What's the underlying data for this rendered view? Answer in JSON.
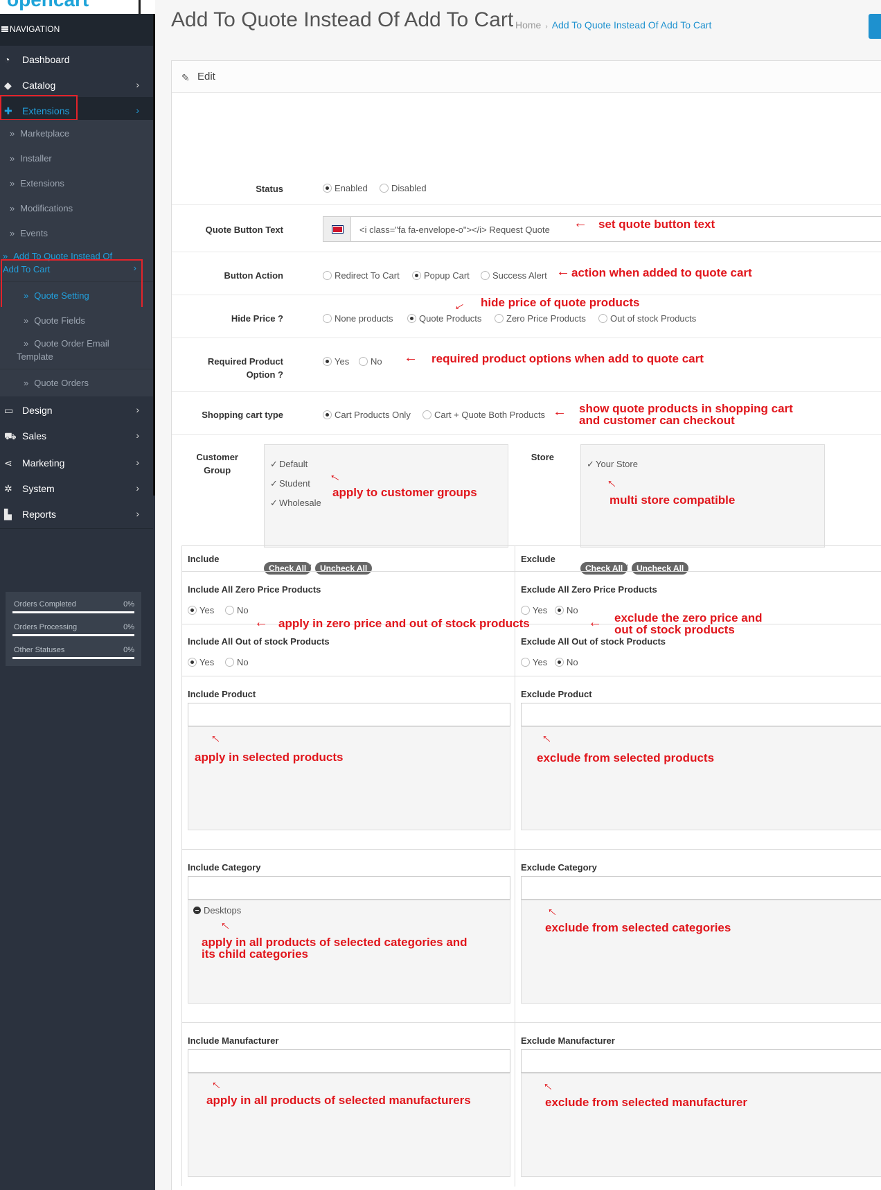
{
  "logo_text": "opencart",
  "sidebar": {
    "nav_header": "NAVIGATION",
    "items": [
      {
        "label": "Dashboard",
        "icon": "dashboard-icon"
      },
      {
        "label": "Catalog",
        "icon": "tag-icon"
      },
      {
        "label": "Extensions",
        "icon": "puzzle-icon"
      },
      {
        "label": "Design",
        "icon": "monitor-icon"
      },
      {
        "label": "Sales",
        "icon": "cart-icon"
      },
      {
        "label": "Marketing",
        "icon": "share-icon"
      },
      {
        "label": "System",
        "icon": "gear-icon"
      },
      {
        "label": "Reports",
        "icon": "bar-chart-icon"
      }
    ],
    "sub_items": [
      "Marketplace",
      "Installer",
      "Extensions",
      "Modifications",
      "Events",
      "Add To Quote Instead Of Add To Cart"
    ],
    "sub_sub_items": [
      "Quote Setting",
      "Quote Fields",
      "Quote Order Email Template",
      "Quote Orders"
    ],
    "stats": [
      {
        "label": "Orders Completed",
        "value": "0%"
      },
      {
        "label": "Orders Processing",
        "value": "0%"
      },
      {
        "label": "Other Statuses",
        "value": "0%"
      }
    ]
  },
  "header": {
    "title": "Add To Quote Instead Of Add To Cart",
    "breadcrumb_home": "Home",
    "breadcrumb_current": "Add To Quote Instead Of Add To Cart"
  },
  "panel": {
    "heading": "Edit",
    "status": {
      "label": "Status",
      "options": [
        "Enabled",
        "Disabled"
      ],
      "selected": "Enabled"
    },
    "quote_button_text": {
      "label": "Quote Button Text",
      "value": "<i class=\"fa fa-envelope-o\"></i> Request Quote"
    },
    "button_action": {
      "label": "Button Action",
      "options": [
        "Redirect To Cart",
        "Popup Cart",
        "Success Alert"
      ],
      "selected": "Popup Cart"
    },
    "hide_price": {
      "label": "Hide Price ?",
      "options": [
        "None products",
        "Quote Products",
        "Zero Price Products",
        "Out of stock Products"
      ],
      "selected": "Quote Products"
    },
    "required_option": {
      "label_line1": "Required Product",
      "label_line2": "Option ?",
      "options": [
        "Yes",
        "No"
      ],
      "selected": "Yes"
    },
    "shopping_cart_type": {
      "label": "Shopping cart type",
      "options": [
        "Cart Products Only",
        "Cart + Quote Both Products"
      ],
      "selected": "Cart Products Only"
    },
    "customer_group": {
      "label_line1": "Customer",
      "label_line2": "Group",
      "items": [
        "Default",
        "Student",
        "Wholesale"
      ]
    },
    "store": {
      "label": "Store",
      "items": [
        "Your Store"
      ]
    },
    "check_all": "Check All",
    "uncheck_all": "Uncheck All",
    "separator": "/"
  },
  "table": {
    "include_header": "Include",
    "exclude_header": "Exclude",
    "include_zero": "Include All Zero Price Products",
    "include_oos": "Include All Out of stock Products",
    "exclude_zero": "Exclude All Zero Price Products",
    "exclude_oos": "Exclude All Out of stock Products",
    "yes": "Yes",
    "no": "No",
    "include_product": "Include Product",
    "exclude_product": "Exclude Product",
    "include_category": "Include Category",
    "exclude_category": "Exclude Category",
    "category_item": "Desktops",
    "include_manufacturer": "Include Manufacturer",
    "exclude_manufacturer": "Exclude Manufacturer"
  },
  "annotations": {
    "quote_text": "set quote button text",
    "button_action": "action when added to quote cart",
    "hide_price": "hide price of quote products",
    "required": "required product options when add to quote cart",
    "cart_type_1": "show quote products in shopping cart",
    "cart_type_2": "and customer can checkout",
    "customer_groups": "apply to customer groups",
    "multistore": "multi store compatible",
    "include_zero": "apply in zero price and out of stock products",
    "exclude_zero_1": "exclude the zero price and",
    "exclude_zero_2": "out of stock products",
    "include_product": "apply in selected products",
    "exclude_product": "exclude from selected products",
    "include_category_1": "apply in all products of selected categories and",
    "include_category_2": "its child categories",
    "exclude_category": "exclude from selected categories",
    "include_manufacturer": "apply in all products of selected manufacturers",
    "exclude_manufacturer": "exclude from selected manufacturer"
  },
  "colors": {
    "sidebar": "#2b323e",
    "accent": "#1e91cf",
    "annotation": "#e1161c"
  }
}
